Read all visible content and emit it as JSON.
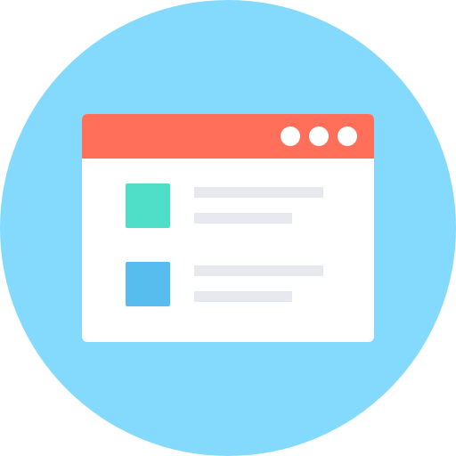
{
  "colors": {
    "circle": "#84dafd",
    "window": "#ffffff",
    "title_bar": "#ff6f5a",
    "window_dots": "#ffffff",
    "text_lines": "#e8e9ee"
  },
  "window": {
    "title_bar": {
      "controls": [
        "dot-icon",
        "dot-icon",
        "dot-icon"
      ]
    },
    "list": {
      "items": [
        {
          "icon": "square-icon",
          "color": "#4fdec7"
        },
        {
          "icon": "square-icon",
          "color": "#56bdee"
        }
      ]
    }
  }
}
